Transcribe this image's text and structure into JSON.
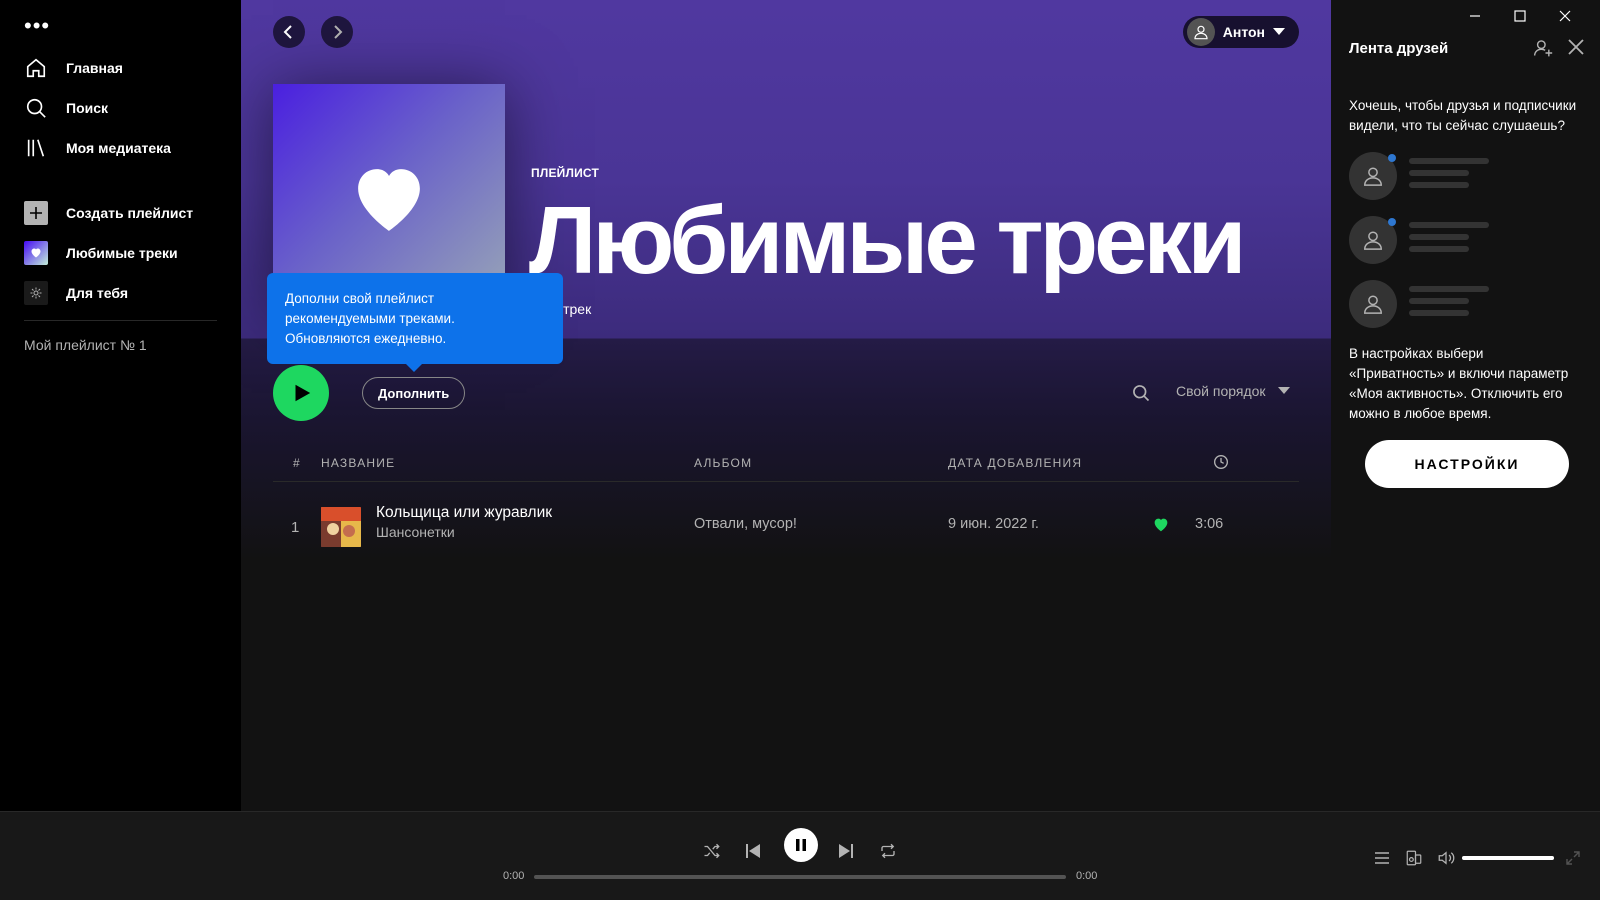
{
  "sidebar": {
    "menu_glyph": "•••",
    "nav": [
      {
        "label": "Главная",
        "icon": "home-icon"
      },
      {
        "label": "Поиск",
        "icon": "search-icon"
      },
      {
        "label": "Моя медиатека",
        "icon": "library-icon"
      }
    ],
    "actions": [
      {
        "label": "Создать плейлист",
        "icon": "plus-icon"
      },
      {
        "label": "Любимые треки",
        "icon": "heart-icon"
      },
      {
        "label": "Для тебя",
        "icon": "sun-icon"
      }
    ],
    "playlists": [
      "Мой плейлист № 1"
    ]
  },
  "header": {
    "user_name": "Антон"
  },
  "playlist": {
    "type_label": "ПЛЕЙЛИСТ",
    "title": "Любимые треки",
    "meta": "н • 1 трек"
  },
  "tooltip": {
    "text_line1": "Дополни свой плейлист",
    "text_line2": "рекомендуемыми треками.",
    "text_line3": "Обновляются ежедневно."
  },
  "controls": {
    "add_label": "Дополнить",
    "sort_label": "Свой порядок"
  },
  "table": {
    "headers": {
      "num": "#",
      "title": "НАЗВАНИЕ",
      "album": "АЛЬБОМ",
      "date": "ДАТА ДОБАВЛЕНИЯ"
    },
    "rows": [
      {
        "num": "1",
        "title": "Кольщица или журавлик",
        "artist": "Шансонетки",
        "album": "Отвали, мусор!",
        "date": "9 июн. 2022 г.",
        "duration": "3:06",
        "liked": true
      }
    ]
  },
  "friends": {
    "title": "Лента друзей",
    "prompt_line1": "Хочешь, чтобы друзья и подписчики",
    "prompt_line2": "видели, что ты сейчас слушаешь?",
    "hint_line1": "В настройках выбери",
    "hint_line2": "«Приватность» и включи параметр",
    "hint_line3": "«Моя активность». Отключить его",
    "hint_line4": "можно в любое время.",
    "settings_label": "НАСТРОЙКИ"
  },
  "player": {
    "elapsed": "0:00",
    "total": "0:00",
    "progress_fraction": 0,
    "volume_fraction": 1.0
  },
  "colors": {
    "accent_green": "#1ed760",
    "tooltip_blue": "#0d72ea",
    "header_purple": "#5038a0"
  }
}
